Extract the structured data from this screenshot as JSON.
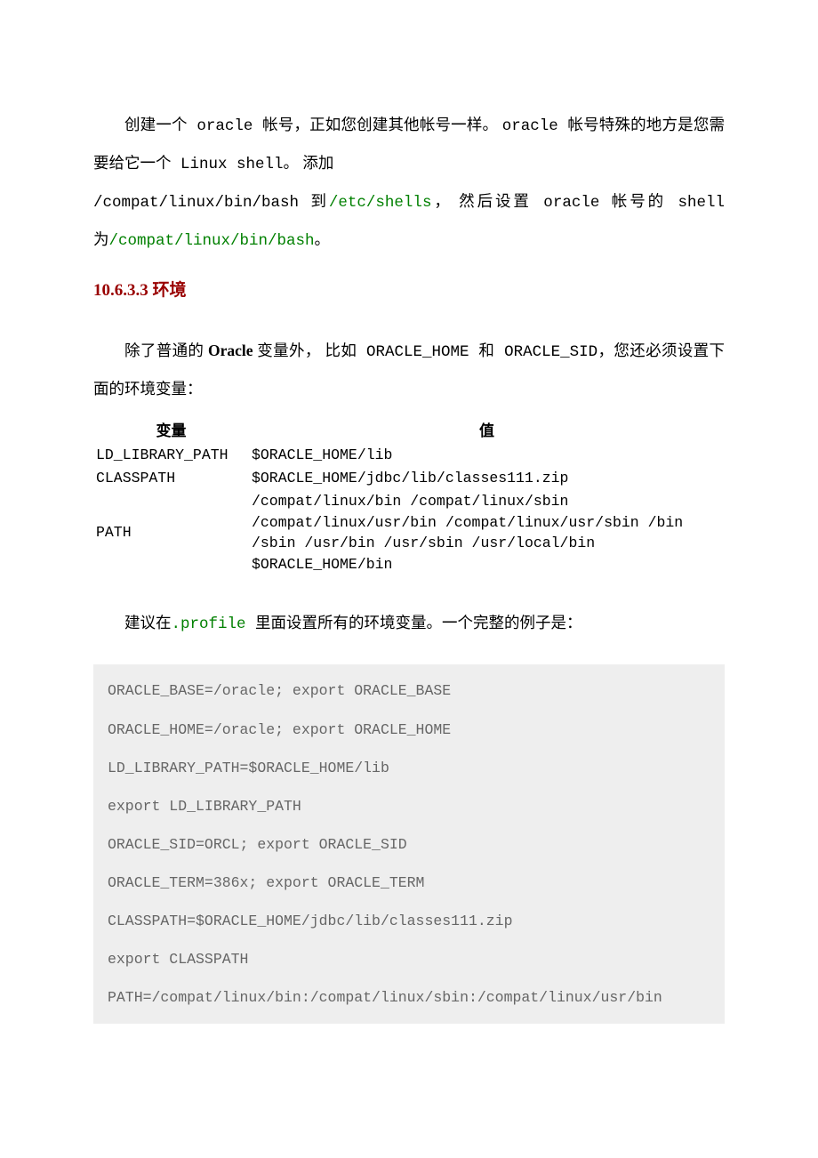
{
  "para1": {
    "seg1": "创建一个",
    "seg2": " oracle ",
    "seg3": "帐号，正如您创建其他帐号一样。 ",
    "seg4": " oracle ",
    "seg5": " 帐号特殊的地方是您需要给它一个",
    "seg6": " Linux shell",
    "seg7": "。 添加",
    "seg8": "/compat/linux/bin/bash ",
    "seg9": "到",
    "seg10": "/etc/shells",
    "seg11": "， 然后设置",
    "seg12": " oracle ",
    "seg13": "帐号的",
    "seg14": " shell ",
    "seg15": "为",
    "seg16": "/compat/linux/bin/bash",
    "seg17": "。"
  },
  "heading": "10.6.3.3 环境",
  "para2": {
    "seg1": "除了普通的",
    "seg2": " Oracle ",
    "seg3": "变量外， 比如",
    "seg4": " ORACLE_HOME ",
    "seg5": "和",
    "seg6": " ORACLE_SID",
    "seg7": "，您还必须设置下面的环境变量："
  },
  "table": {
    "head_var": "变量",
    "head_val": "值",
    "rows": [
      {
        "var": "LD_LIBRARY_PATH",
        "val": "$ORACLE_HOME/lib"
      },
      {
        "var": "CLASSPATH",
        "val": "$ORACLE_HOME/jdbc/lib/classes111.zip"
      },
      {
        "var": "PATH",
        "val": "/compat/linux/bin /compat/linux/sbin /compat/linux/usr/bin /compat/linux/usr/sbin /bin /sbin /usr/bin /usr/sbin /usr/local/bin $ORACLE_HOME/bin"
      }
    ]
  },
  "para3": {
    "seg1": "建议在",
    "seg2": ".profile ",
    "seg3": "里面设置所有的环境变量。一个完整的例子是："
  },
  "code": {
    "lines": [
      "ORACLE_BASE=/oracle; export ORACLE_BASE",
      "ORACLE_HOME=/oracle; export ORACLE_HOME",
      "LD_LIBRARY_PATH=$ORACLE_HOME/lib",
      "export LD_LIBRARY_PATH",
      "ORACLE_SID=ORCL; export ORACLE_SID",
      "ORACLE_TERM=386x; export ORACLE_TERM",
      "CLASSPATH=$ORACLE_HOME/jdbc/lib/classes111.zip",
      "export CLASSPATH",
      "PATH=/compat/linux/bin:/compat/linux/sbin:/compat/linux/usr/bin"
    ]
  }
}
